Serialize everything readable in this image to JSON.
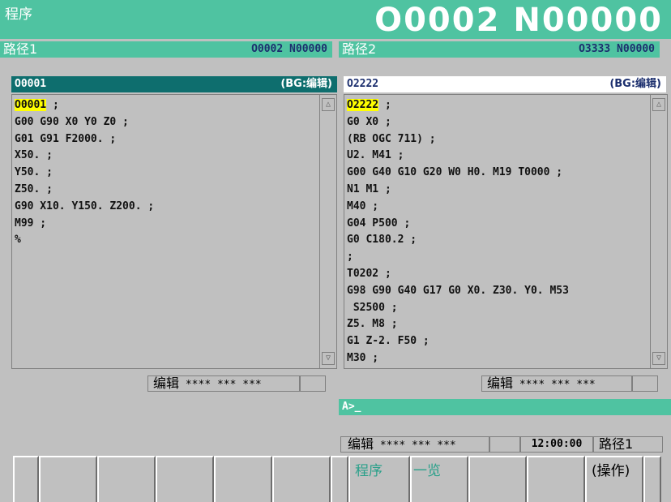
{
  "header": {
    "title": "程序",
    "number": "O0002 N00000"
  },
  "path1": {
    "label": "路径1",
    "number": "O0002 N00000"
  },
  "path2": {
    "label": "路径2",
    "number": "O3333 N00000"
  },
  "left_pane": {
    "prog": "O0001",
    "mode": "(BG:编辑)",
    "first_prog": "O0001",
    "first_tail": " ;",
    "lines": [
      "G00 G90 X0 Y0 Z0 ;",
      "G01 G91 F2000. ;",
      "X50. ;",
      "Y50. ;",
      "Z50. ;",
      "G90 X10. Y150. Z200. ;",
      "M99 ;",
      "%"
    ]
  },
  "right_pane": {
    "prog": "O2222",
    "mode": "(BG:编辑)",
    "first_prog": "O2222",
    "first_tail": " ;",
    "lines": [
      "G0 X0 ;",
      "(RB OGC 711) ;",
      "U2. M41 ;",
      "G00 G40 G10 G20 W0 H0. M19 T0000 ;",
      "N1 M1 ;",
      "M40 ;",
      "G04 P500 ;",
      "G0 C180.2 ;",
      ";",
      "T0202 ;",
      "G98 G90 G40 G17 G0 X0. Z30. Y0. M53",
      " S2500 ;",
      "Z5. M8 ;",
      "G1 Z-2. F50 ;",
      "M30 ;"
    ]
  },
  "status_left": {
    "mode": "编辑",
    "stars": "**** *** ***"
  },
  "status_right": {
    "mode": "编辑",
    "stars": "**** *** ***"
  },
  "input": {
    "prompt": "A>_"
  },
  "bottom_status": {
    "mode": "编辑",
    "stars": "**** *** ***",
    "time": "12:00:00",
    "path": "路径1"
  },
  "softkeys": {
    "k6": "程序",
    "k7": "一览",
    "k10": "(操作)"
  },
  "colors": {
    "teal": "#4fc3a1",
    "dark_teal": "#0e6e6e",
    "highlight": "#ffff00"
  }
}
